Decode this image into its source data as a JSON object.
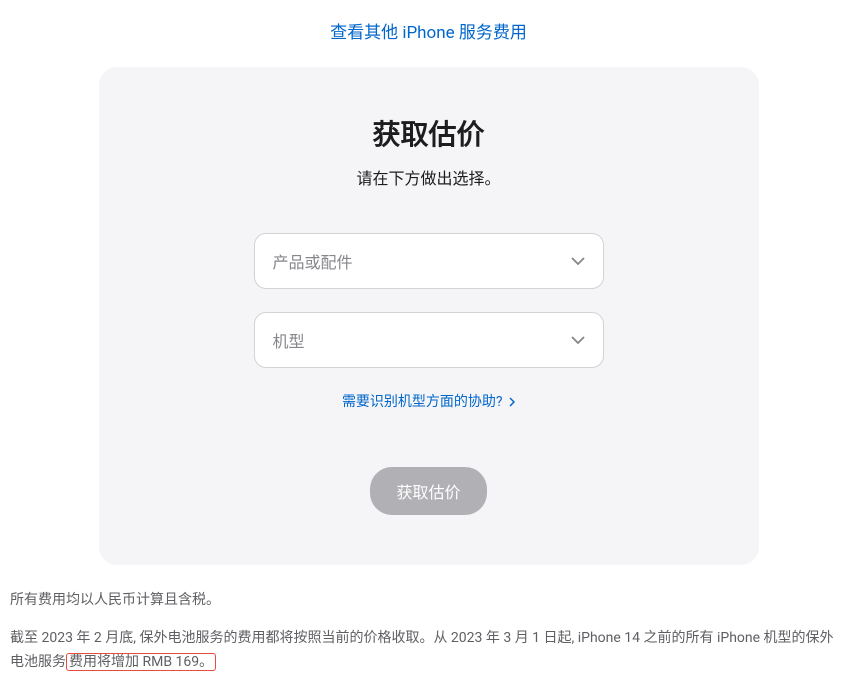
{
  "topLink": "查看其他 iPhone 服务费用",
  "card": {
    "title": "获取估价",
    "subtitle": "请在下方做出选择。",
    "productSelect": "产品或配件",
    "modelSelect": "机型",
    "helpLink": "需要识别机型方面的协助?",
    "submitButton": "获取估价"
  },
  "disclaimer": {
    "line1": "所有费用均以人民币计算且含税。",
    "line2a": "截至 2023 年 2 月底, 保外电池服务的费用都将按照当前的价格收取。从 2023 年 3 月 1 日起, iPhone 14 之前的所有 iPhone 机型的保外电池服务",
    "line2b": "费用将增加 RMB 169。"
  }
}
